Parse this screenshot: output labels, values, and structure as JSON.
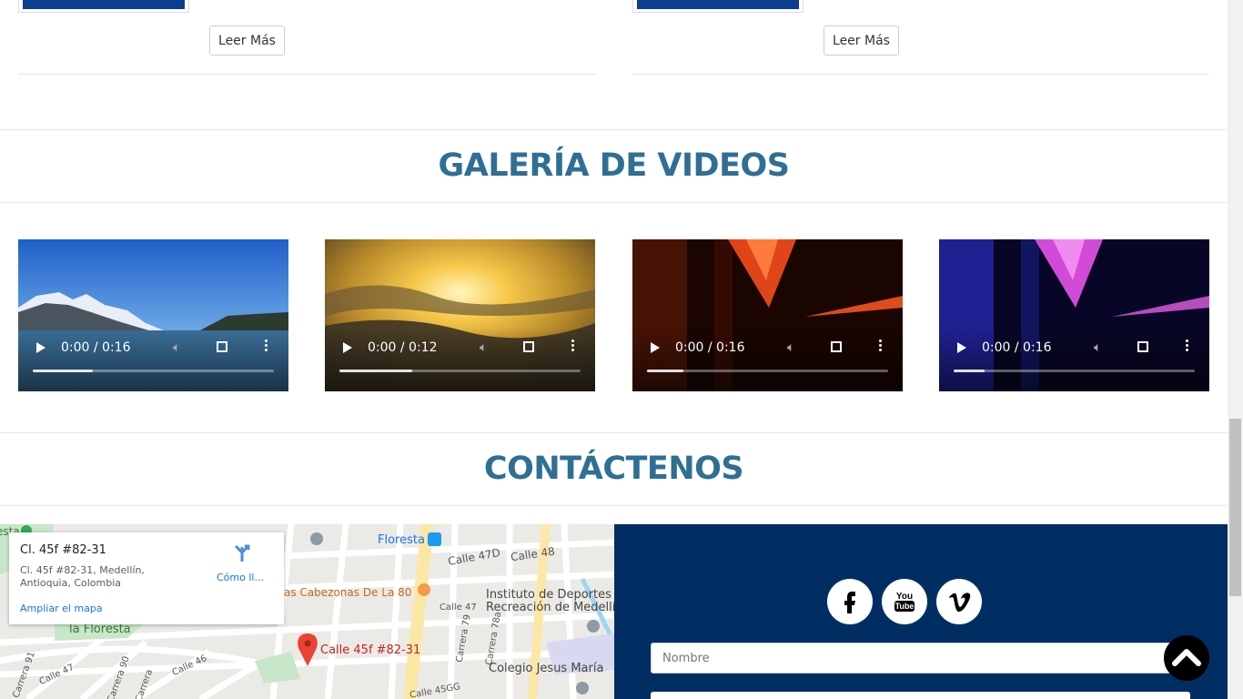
{
  "news": {
    "read_more_label": "Leer Más"
  },
  "videos_section": {
    "title": "GALERÍA DE VIDEOS",
    "videos": [
      {
        "time": "0:00 / 0:16",
        "played_fraction": 0,
        "buffered_fraction": 0.25
      },
      {
        "time": "0:00 / 0:12",
        "played_fraction": 0,
        "buffered_fraction": 0.3
      },
      {
        "time": "0:00 / 0:16",
        "played_fraction": 0,
        "buffered_fraction": 0.15
      },
      {
        "time": "0:00 / 0:16",
        "played_fraction": 0,
        "buffered_fraction": 0.13
      }
    ]
  },
  "contact_section": {
    "title": "CONTÁCTENOS",
    "map": {
      "place_title": "Cl. 45f #82-31",
      "place_address": "Cl. 45f #82-31, Medellín, Antioquia, Colombia",
      "enlarge_label": "Ampliar el mapa",
      "directions_label": "Cómo ll...",
      "marker_label": "Calle 45f #82-31",
      "labels": {
        "floresta_station": "Floresta",
        "la_floresta": "la Floresta",
        "calle_47d": "Calle 47D",
        "calle_48": "Calle 48",
        "calle_47": "Calle 47",
        "calle_47_b": "Calle 47",
        "calle_46": "Calle 46",
        "calle_45gg": "Calle 45GG",
        "carrera_79": "Carrera 79",
        "carrera_78a": "Carrera 78a",
        "carrera_90": "Carrera 90",
        "carrera_91": "Carrera 91",
        "carrera": "Carrera",
        "restaurant": "as Cabezonas De La 80",
        "instituto_1": "Instituto de Deportes y",
        "instituto_2": "Recreación de Medellín",
        "colegio": "Colegio Jesus María",
        "resta": "esta"
      }
    },
    "form": {
      "name_placeholder": "Nombre"
    },
    "social": [
      "facebook-icon",
      "youtube-icon",
      "vimeo-icon"
    ],
    "colors": {
      "panel_bg": "#002e63",
      "title": "#2f6f94"
    }
  }
}
